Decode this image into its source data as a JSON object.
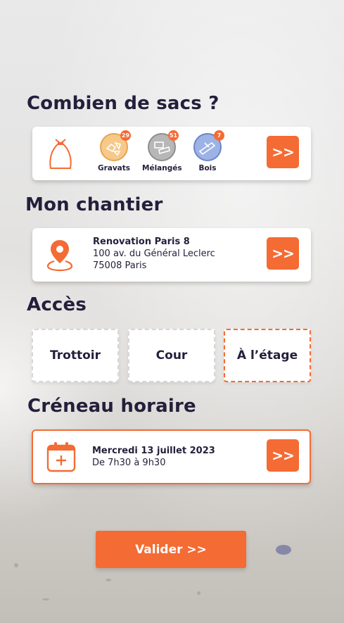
{
  "colors": {
    "accent": "#f46b34",
    "text": "#231f3b",
    "gravats": "#f6c98a",
    "melanges": "#b7b7b7",
    "bois": "#9db3e6"
  },
  "bags": {
    "title": "Combien de sacs ?",
    "bag_icon": "sack-icon",
    "items": [
      {
        "label": "Gravats",
        "count": "29",
        "icon": "rubble-icon"
      },
      {
        "label": "Mélangés",
        "count": "51",
        "icon": "mixed-waste-icon"
      },
      {
        "label": "Bois",
        "count": "7",
        "icon": "wood-icon"
      }
    ],
    "next_label": ">>"
  },
  "site": {
    "title": "Mon chantier",
    "icon": "location-pin-icon",
    "name": "Renovation Paris 8",
    "address": "100 av. du Général Leclerc",
    "city": "75008 Paris",
    "next_label": ">>"
  },
  "access": {
    "title": "Accès",
    "options": [
      "Trottoir",
      "Cour",
      "À l’étage"
    ],
    "selected": "À l’étage"
  },
  "slot": {
    "title": "Créneau horaire",
    "icon": "calendar-add-icon",
    "date": "Mercredi 13 juillet 2023",
    "time": "De 7h30 à 9h30",
    "next_label": ">>"
  },
  "submit_label": "Valider >>"
}
